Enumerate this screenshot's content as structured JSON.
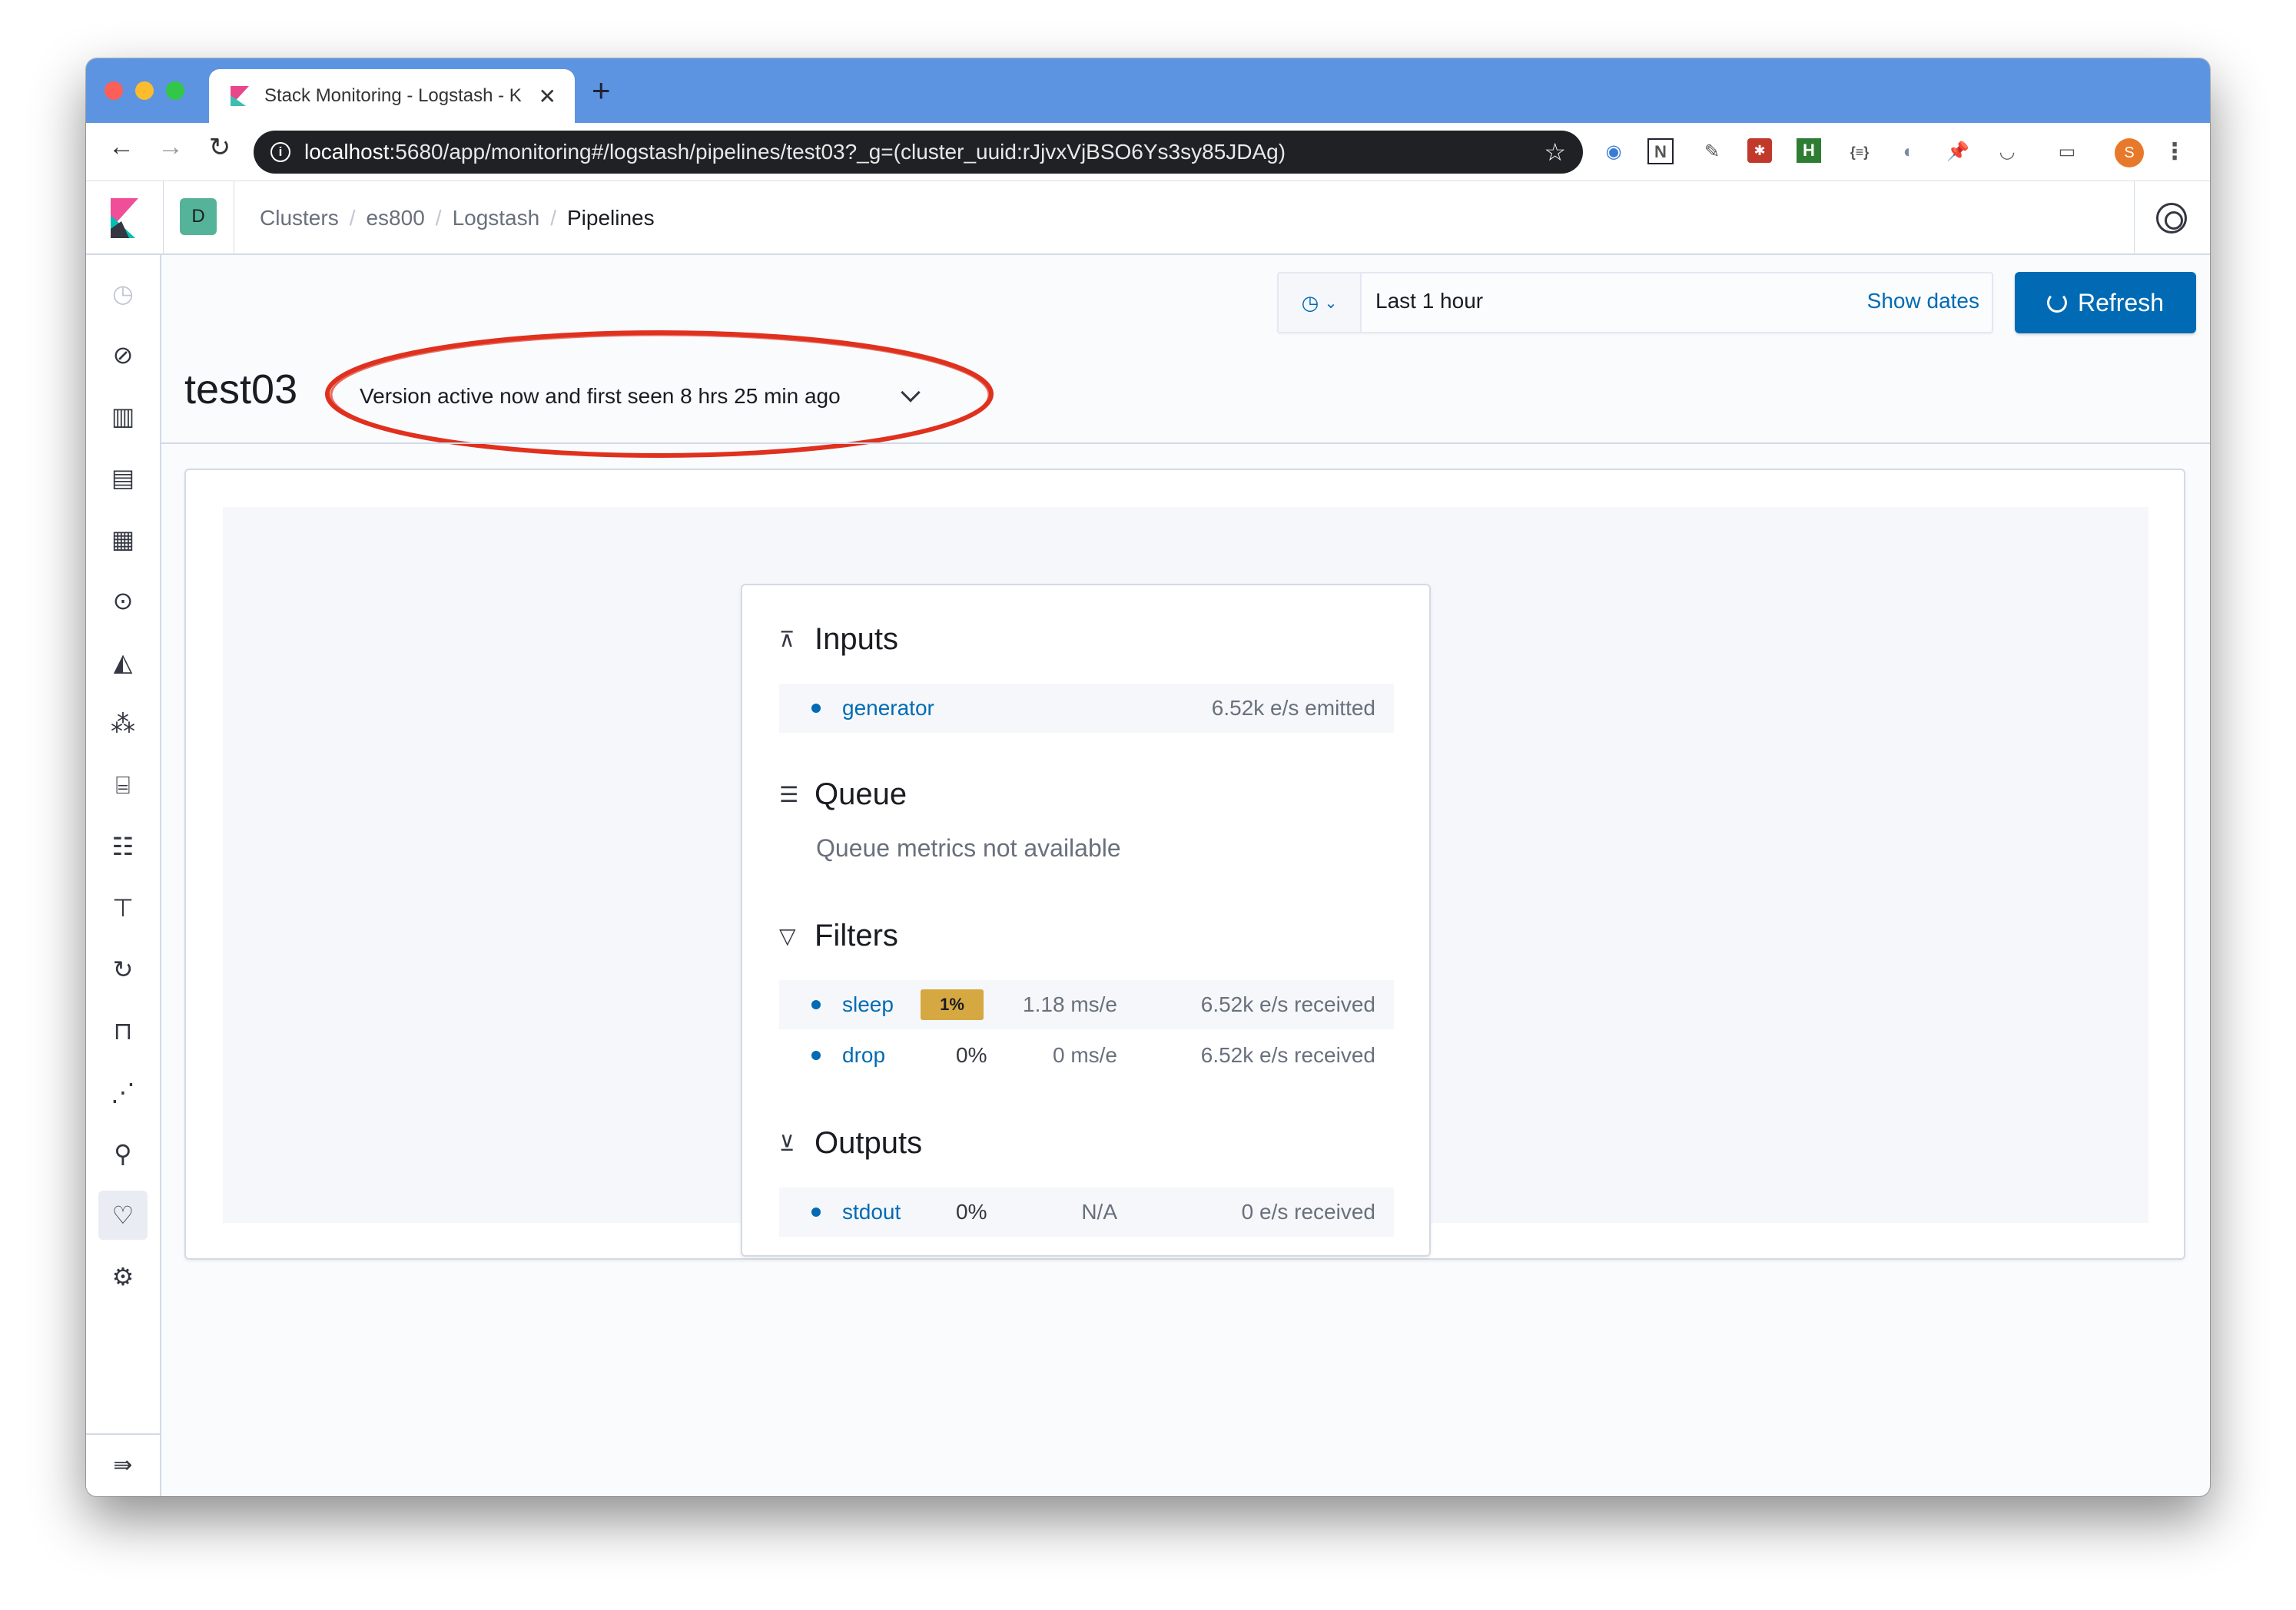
{
  "browser": {
    "tab_title": "Stack Monitoring - Logstash - K",
    "url_host": "localhost",
    "url_rest": ":5680/app/monitoring#/logstash/pipelines/test03?_g=(cluster_uuid:rJjvxVjBSO6Ys3sy85JDAg)",
    "profile_initial": "S"
  },
  "header": {
    "space_initial": "D",
    "breadcrumbs": [
      "Clusters",
      "es800",
      "Logstash",
      "Pipelines"
    ]
  },
  "timepicker": {
    "range": "Last 1 hour",
    "show_dates": "Show dates",
    "refresh": "Refresh"
  },
  "pipeline": {
    "id": "test03",
    "version_label": "Version active now and first seen 8 hrs 25 min ago"
  },
  "sections": {
    "inputs": {
      "title": "Inputs",
      "rows": [
        {
          "name": "generator",
          "events": "6.52k e/s emitted"
        }
      ]
    },
    "queue": {
      "title": "Queue",
      "message": "Queue metrics not available"
    },
    "filters": {
      "title": "Filters",
      "rows": [
        {
          "name": "sleep",
          "pct": "1%",
          "latency": "1.18 ms/e",
          "events": "6.52k e/s received"
        },
        {
          "name": "drop",
          "pct": "0%",
          "latency": "0 ms/e",
          "events": "6.52k e/s received"
        }
      ]
    },
    "outputs": {
      "title": "Outputs",
      "rows": [
        {
          "name": "stdout",
          "pct": "0%",
          "latency": "N/A",
          "events": "0 e/s received"
        }
      ]
    }
  },
  "colors": {
    "accent": "#006bb4",
    "hot_badge": "#d6a842",
    "annotation_ring": "#e0301e",
    "chrome_bar": "#5c94e2"
  }
}
